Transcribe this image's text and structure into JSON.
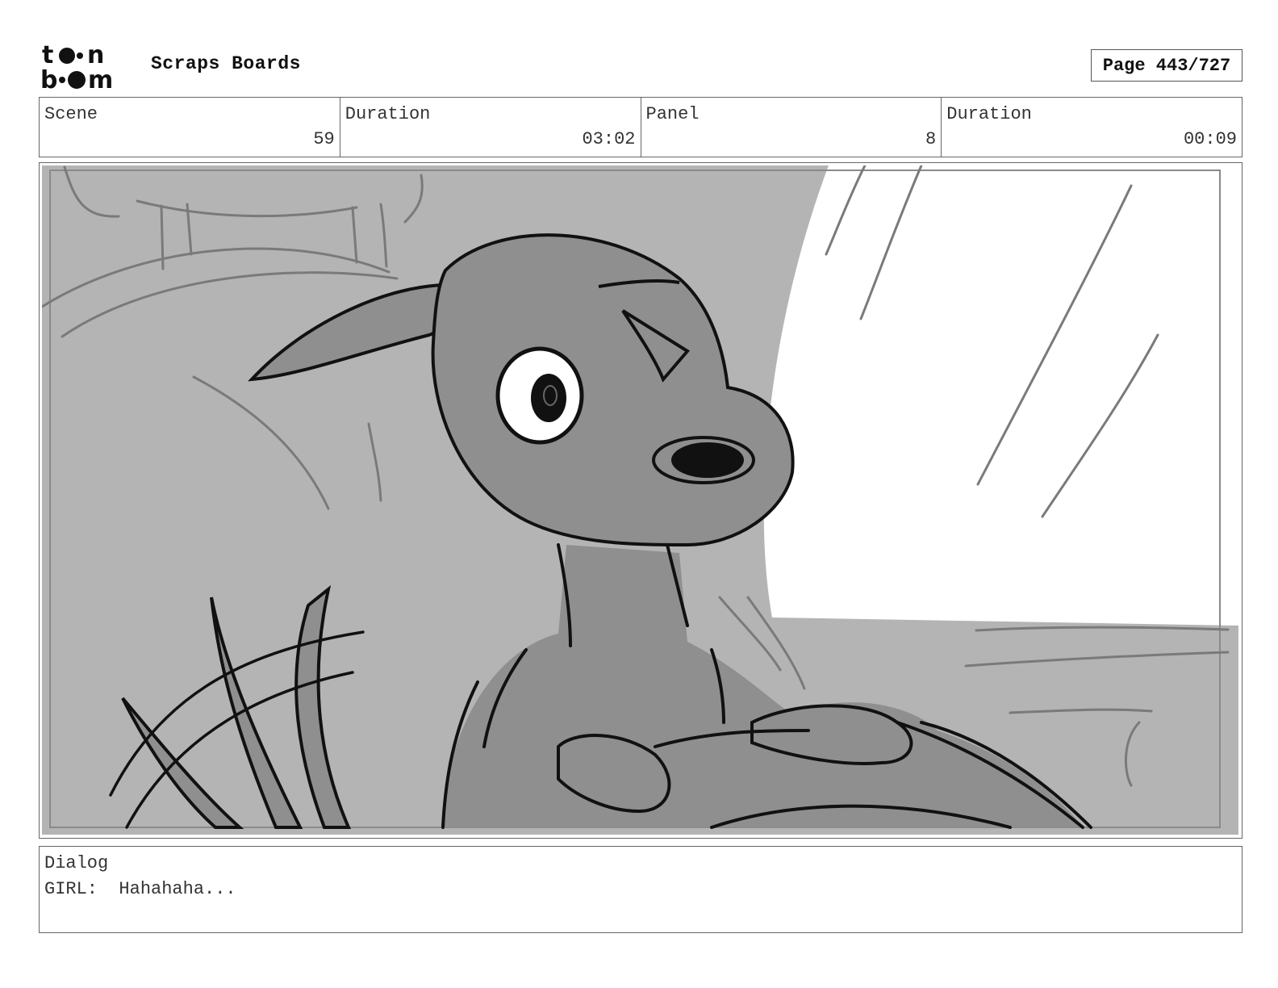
{
  "header": {
    "logo": {
      "icon": "toonboom-logo-icon",
      "text": "toon boom"
    },
    "project_title": "Scraps Boards",
    "page": "Page 443/727"
  },
  "info": {
    "scene_label": "Scene",
    "scene_value": "59",
    "scene_duration_label": "Duration",
    "scene_duration_value": "03:02",
    "panel_label": "Panel",
    "panel_value": "8",
    "panel_duration_label": "Duration",
    "panel_duration_value": "00:09"
  },
  "panel": {
    "image": "storyboard-sketch-dog-looking-up",
    "colors": {
      "background": "#b4b4b4",
      "character": "#8f8f8f",
      "window": "#ffffff",
      "ink": "#111111"
    }
  },
  "dialog": {
    "label": "Dialog",
    "text": "GIRL:  Hahahaha..."
  }
}
